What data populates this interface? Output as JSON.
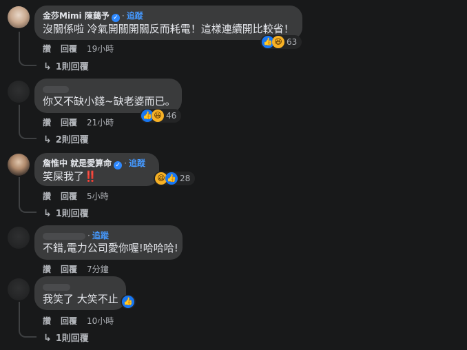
{
  "comments": [
    {
      "name": "金莎Mimi 陳藹予",
      "verified": true,
      "follow": "追蹤",
      "text": "沒關係啦 冷氣開關開關反而耗電！這樣連續開比較省！",
      "actions": {
        "like": "讚",
        "reply": "回覆",
        "time": "19小時"
      },
      "reaction_count": "63",
      "reactions": [
        "like-icon",
        "haha-icon"
      ],
      "replies": "1則回覆"
    },
    {
      "name": "",
      "verified": false,
      "text": "你又不缺小錢~缺老婆而已。",
      "actions": {
        "like": "讚",
        "reply": "回覆",
        "time": "21小時"
      },
      "reaction_count": "46",
      "reactions": [
        "like-icon",
        "haha-icon"
      ],
      "replies": "2則回覆"
    },
    {
      "name": "詹惟中 就是愛算命",
      "verified": true,
      "follow": "追蹤",
      "text": "笑屎我了",
      "emoji": "‼️",
      "actions": {
        "like": "讚",
        "reply": "回覆",
        "time": "5小時"
      },
      "reaction_count": "28",
      "reactions": [
        "haha-icon",
        "like-icon"
      ],
      "replies": "1則回覆"
    },
    {
      "name": "",
      "follow": "追蹤",
      "text": "不錯,電力公司愛你喔!哈哈哈!",
      "actions": {
        "like": "讚",
        "reply": "回覆",
        "time": "7分鐘"
      }
    },
    {
      "name": "",
      "text": "我笑了 大笑不止",
      "actions": {
        "like": "讚",
        "reply": "回覆",
        "time": "10小時"
      },
      "reactions": [
        "like-icon"
      ],
      "replies": "1則回覆"
    }
  ],
  "colors": {
    "background": "#18191a",
    "bubble": "#3a3b3c",
    "link": "#4599ff",
    "like": "#1877f2",
    "haha": "#f7b125"
  }
}
